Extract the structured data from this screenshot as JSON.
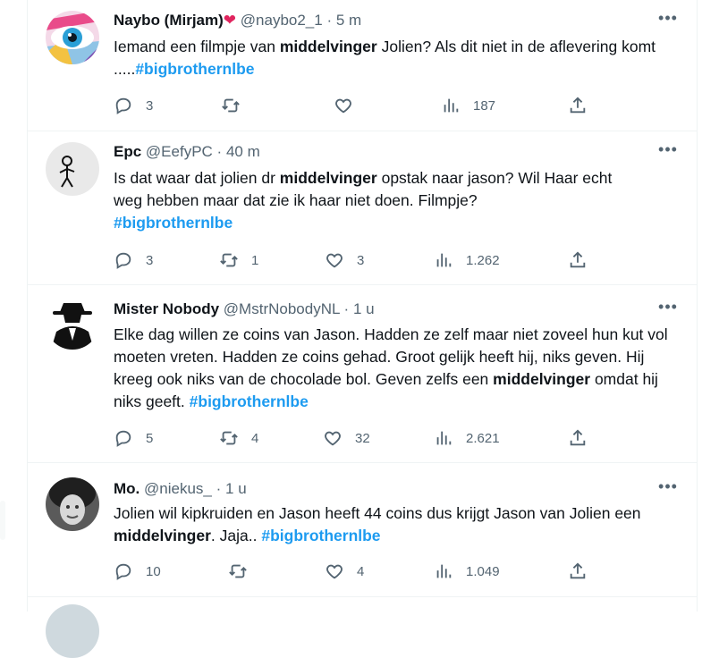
{
  "colors": {
    "accent": "#1d9bf0",
    "heart": "#e0245e",
    "muted": "#536471"
  },
  "tweets": [
    {
      "name": "Naybo (Mirjam)",
      "name_emoji": "❤",
      "handle": "@naybo2_1",
      "sep": "·",
      "time": "5 m",
      "text_parts": [
        "Iemand een filmpje van ",
        "middelvinger",
        " Jolien? Als dit niet in de aflevering komt .....",
        "#bigbrothernlbe"
      ],
      "replies": "3",
      "retweets": "",
      "likes": "",
      "views": "187"
    },
    {
      "name": "Epc",
      "handle": "@EefyPC",
      "sep": "·",
      "time": "40 m",
      "text_parts": [
        "Is dat waar dat jolien dr ",
        "middelvinger",
        " opstak naar jason? Wil Haar echt weg hebben maar dat zie ik haar niet doen. Filmpje?",
        "#bigbrothernlbe"
      ],
      "replies": "3",
      "retweets": "1",
      "likes": "3",
      "views": "1.262"
    },
    {
      "name": "Mister Nobody",
      "handle": "@MstrNobodyNL",
      "sep": "·",
      "time": "1 u",
      "text_parts": [
        "Elke dag willen ze coins van Jason.  Hadden ze zelf maar niet zoveel hun kut vol moeten vreten.  Hadden ze coins gehad.  Groot gelijk heeft hij, niks geven. Hij kreeg ook niks van de chocolade bol. Geven zelfs een ",
        "middelvinger",
        " omdat hij niks geeft. ",
        "#bigbrothernlbe"
      ],
      "replies": "5",
      "retweets": "4",
      "likes": "32",
      "views": "2.621"
    },
    {
      "name": "Mo.",
      "handle": "@niekus_",
      "sep": "·",
      "time": "1 u",
      "text_parts": [
        "Jolien wil kipkruiden en Jason heeft 44 coins dus krijgt Jason van Jolien een ",
        "middelvinger",
        ". Jaja..  ",
        "#bigbrothernlbe"
      ],
      "replies": "10",
      "retweets": "",
      "likes": "4",
      "views": "1.049"
    }
  ]
}
